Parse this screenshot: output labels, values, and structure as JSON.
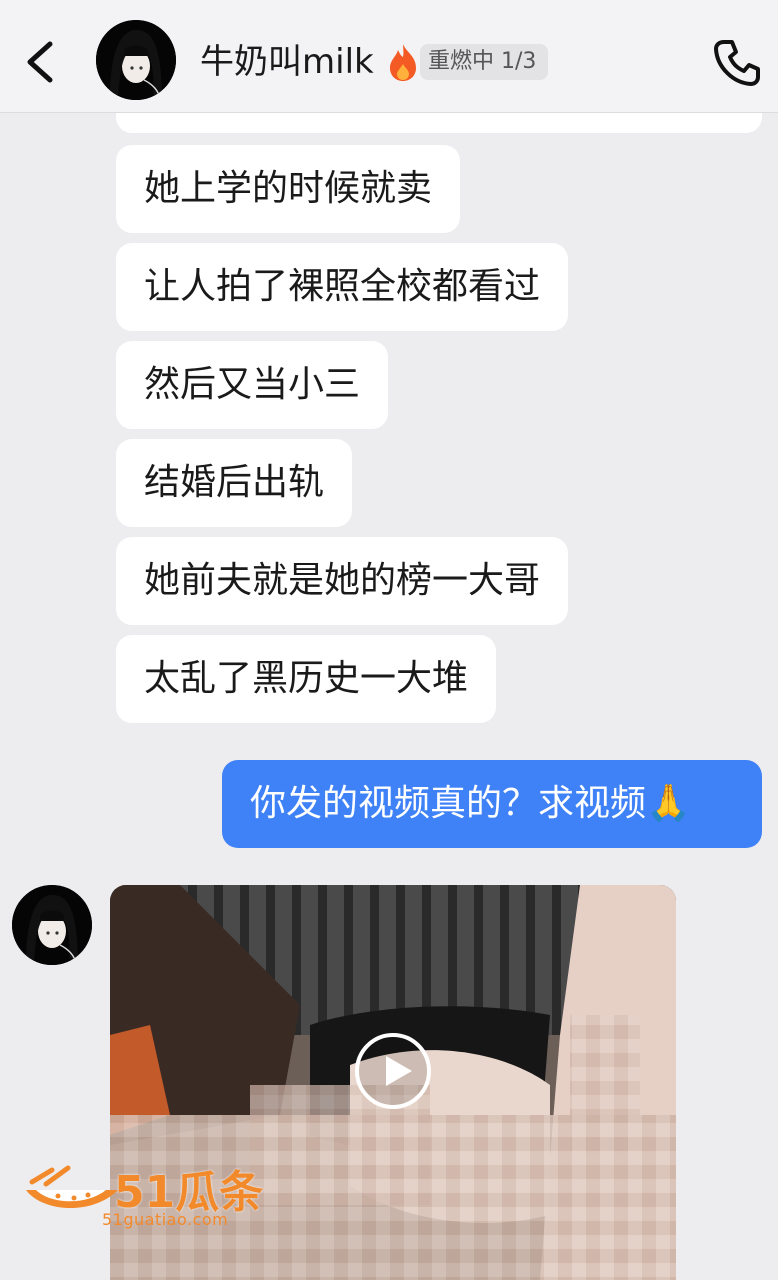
{
  "header": {
    "title": "牛奶叫milk",
    "reburn_badge": "重燃中 1/3",
    "back_icon": "chevron-left-icon",
    "phone_icon": "phone-icon"
  },
  "messages": [
    {
      "text": "她上学的时候就卖"
    },
    {
      "text": "让人拍了裸照全校都看过"
    },
    {
      "text": "然后又当小三"
    },
    {
      "text": "结婚后出轨"
    },
    {
      "text": "她前夫就是她的榜一大哥"
    },
    {
      "text": "太乱了黑历史一大堆"
    }
  ],
  "sent": {
    "text": "你发的视频真的？求视频",
    "emoji": "🙏"
  },
  "video": {
    "play_icon": "play-icon"
  },
  "watermark": {
    "brand": "51瓜条",
    "url": "51guatiao.com"
  },
  "colors": {
    "background": "#ededf0",
    "sent_bubble": "#3f82f7",
    "received_bubble": "#ffffff",
    "watermark": "#f28a2b"
  }
}
